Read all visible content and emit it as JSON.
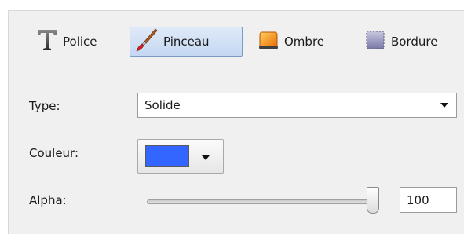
{
  "toolbar": {
    "tabs": [
      {
        "label": "Police",
        "icon": "text-t-icon"
      },
      {
        "label": "Pinceau",
        "icon": "paintbrush-icon",
        "active": true
      },
      {
        "label": "Ombre",
        "icon": "shadow-icon"
      },
      {
        "label": "Bordure",
        "icon": "border-icon"
      }
    ]
  },
  "fields": {
    "type_label": "Type:",
    "type_value": "Solide",
    "couleur_label": "Couleur:",
    "couleur_value": "#3366ff",
    "alpha_label": "Alpha:",
    "alpha_value": "100",
    "alpha_fraction": 1.0
  },
  "colors": {
    "accent_active_border": "#7a9cc8",
    "shadow_orange": "#f07a00",
    "border_purple": "#8080b0"
  }
}
